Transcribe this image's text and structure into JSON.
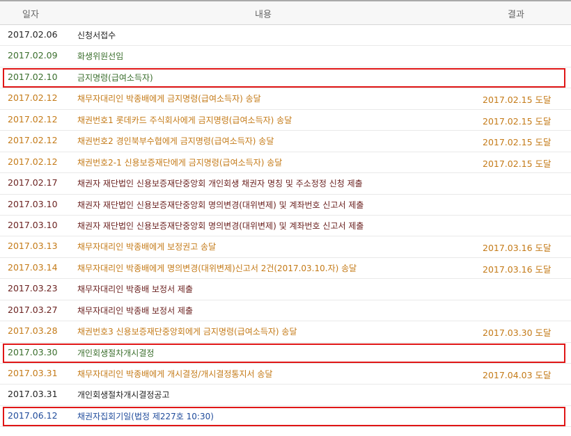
{
  "header": {
    "date": "일자",
    "content": "내용",
    "result": "결과"
  },
  "colors": {
    "black": "#222222",
    "green": "#3a6e2c",
    "orange": "#c47a17",
    "maroon": "#6b2220",
    "blue": "#1f4b9b",
    "highlight_border": "#e01616"
  },
  "rows": [
    {
      "date": "2017.02.06",
      "content": "신청서접수",
      "result": "",
      "color": "black",
      "highlighted": false
    },
    {
      "date": "2017.02.09",
      "content": "화생위원선임",
      "result": "",
      "color": "green",
      "highlighted": false
    },
    {
      "date": "2017.02.10",
      "content": "금지명령(급여소득자)",
      "result": "",
      "color": "green",
      "highlighted": true
    },
    {
      "date": "2017.02.12",
      "content": "채무자대리인 박종배에게 금지명령(급여소득자) 송달",
      "result": "2017.02.15 도달",
      "color": "orange",
      "highlighted": false
    },
    {
      "date": "2017.02.12",
      "content": "채권번호1 롯데카드 주식회사에게 금지명령(급여소득자) 송달",
      "result": "2017.02.15 도달",
      "color": "orange",
      "highlighted": false
    },
    {
      "date": "2017.02.12",
      "content": "채권번호2 경인북부수협에게 금지명령(급여소득자) 송달",
      "result": "2017.02.15 도달",
      "color": "orange",
      "highlighted": false
    },
    {
      "date": "2017.02.12",
      "content": "채권번호2-1 신용보증재단에게 금지명령(급여소득자) 송달",
      "result": "2017.02.15 도달",
      "color": "orange",
      "highlighted": false
    },
    {
      "date": "2017.02.17",
      "content": "채권자 재단법인 신용보증재단중앙회 개인회생 채권자 명칭 및 주소정정 신청 제출",
      "result": "",
      "color": "maroon",
      "highlighted": false
    },
    {
      "date": "2017.03.10",
      "content": "채권자 재단법인 신용보증재단중앙회 명의변경(대위변제) 및 계좌번호 신고서 제출",
      "result": "",
      "color": "maroon",
      "highlighted": false
    },
    {
      "date": "2017.03.10",
      "content": "채권자 재단법인 신용보증재단중앙회 명의변경(대위변제) 및 계좌번호 신고서 제출",
      "result": "",
      "color": "maroon",
      "highlighted": false
    },
    {
      "date": "2017.03.13",
      "content": "채무자대리인 박종배에게 보정권고 송달",
      "result": "2017.03.16 도달",
      "color": "orange",
      "highlighted": false
    },
    {
      "date": "2017.03.14",
      "content": "채무자대리인 박종배에게 명의변경(대위변제)신고서 2건(2017.03.10.자) 송달",
      "result": "2017.03.16 도달",
      "color": "orange",
      "highlighted": false
    },
    {
      "date": "2017.03.23",
      "content": "채무자대리인 박종배 보정서 제출",
      "result": "",
      "color": "maroon",
      "highlighted": false
    },
    {
      "date": "2017.03.27",
      "content": "채무자대리인 박종배 보정서 제출",
      "result": "",
      "color": "maroon",
      "highlighted": false
    },
    {
      "date": "2017.03.28",
      "content": "채권번호3 신용보증재단중앙회에게 금지명령(급여소득자) 송달",
      "result": "2017.03.30 도달",
      "color": "orange",
      "highlighted": false
    },
    {
      "date": "2017.03.30",
      "content": "개인회생절차개시결정",
      "result": "",
      "color": "green",
      "highlighted": true
    },
    {
      "date": "2017.03.31",
      "content": "채무자대리인 박종배에게 개시결정/개시결정통지서 송달",
      "result": "2017.04.03 도달",
      "color": "orange",
      "highlighted": false
    },
    {
      "date": "2017.03.31",
      "content": "개인회생절차개시결정공고",
      "result": "",
      "color": "black",
      "highlighted": false
    },
    {
      "date": "2017.06.12",
      "content": "채권자집회기일(법정 제227호 10:30)",
      "result": "",
      "color": "blue",
      "highlighted": true
    }
  ]
}
